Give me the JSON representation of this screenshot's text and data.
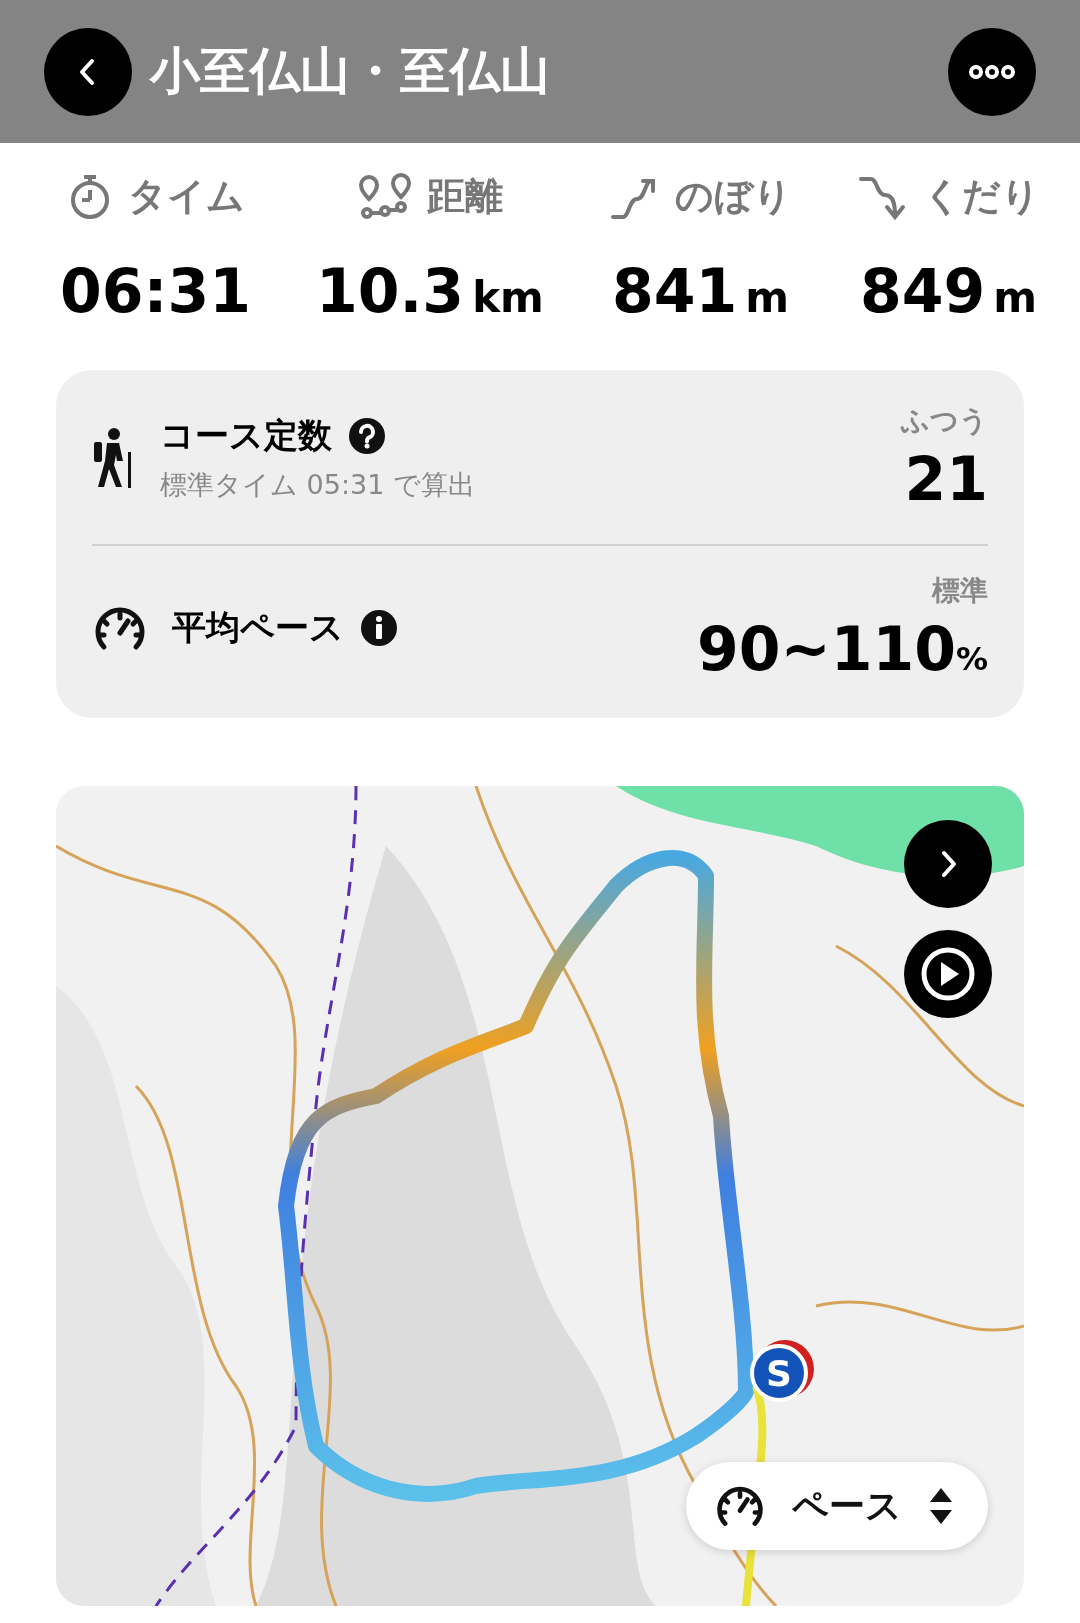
{
  "header": {
    "title": "小至仏山・至仏山"
  },
  "stats": [
    {
      "kind": "time",
      "label": "タイム",
      "value": "06:31"
    },
    {
      "kind": "distance",
      "label": "距離",
      "value": "10.3",
      "unit": "km"
    },
    {
      "kind": "ascent",
      "label": "のぼり",
      "value": "841",
      "unit": "m"
    },
    {
      "kind": "descent",
      "label": "くだり",
      "value": "849",
      "unit": "m"
    }
  ],
  "summary": [
    {
      "kind": "course",
      "title": "コース定数",
      "help": {
        "kind": "question"
      },
      "note": "標準タイム 05:31 で算出",
      "rating": "ふつう",
      "value": "21"
    },
    {
      "kind": "pace",
      "title": "平均ペース",
      "help": {
        "kind": "info"
      },
      "rating": "標準",
      "value": "90~110",
      "unit": "%"
    }
  ],
  "map": {
    "controls": [
      {
        "kind": "next"
      },
      {
        "kind": "play"
      }
    ],
    "start_marker": "S",
    "mode_selector": "ペース"
  }
}
